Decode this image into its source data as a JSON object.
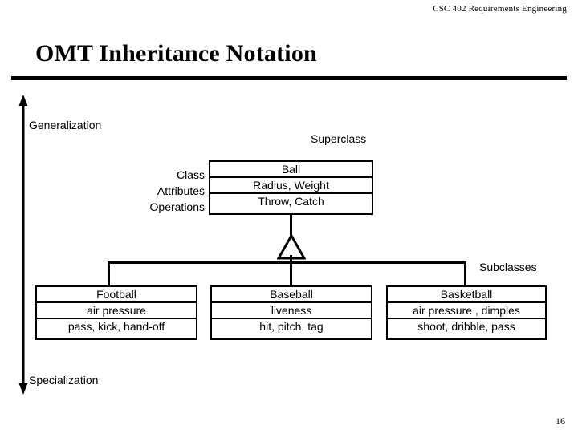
{
  "slide": {
    "course_header": "CSC 402 Requirements Engineering",
    "title": "OMT Inheritance Notation",
    "page_number": "16"
  },
  "axis": {
    "top_label": "Generalization",
    "bottom_label": "Specialization"
  },
  "labels": {
    "superclass": "Superclass",
    "subclasses": "Subclasses"
  },
  "compartment_labels": {
    "class": "Class",
    "attributes": "Attributes",
    "operations": "Operations"
  },
  "superclass_box": {
    "name": "Ball",
    "attributes": "Radius, Weight",
    "operations": "Throw, Catch"
  },
  "subclass_boxes": [
    {
      "name": "Football",
      "attributes": "air pressure",
      "operations": "pass, kick, hand-off"
    },
    {
      "name": "Baseball",
      "attributes": "liveness",
      "operations": "hit, pitch, tag"
    },
    {
      "name": "Basketball",
      "attributes": "air pressure , dimples",
      "operations": "shoot, dribble, pass"
    }
  ],
  "colors": {
    "background": "#ffffff",
    "foreground": "#000000"
  }
}
